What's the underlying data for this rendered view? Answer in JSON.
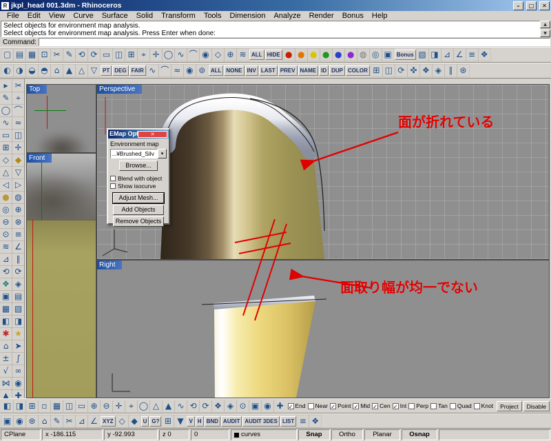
{
  "window": {
    "title": "jkpl_head 001.3dm - Rhinoceros",
    "min": "–",
    "max": "□",
    "close": "✕"
  },
  "menu": {
    "items": [
      "File",
      "Edit",
      "View",
      "Curve",
      "Surface",
      "Solid",
      "Transform",
      "Tools",
      "Dimension",
      "Analyze",
      "Render",
      "Bonus",
      "Help"
    ]
  },
  "command": {
    "history": [
      "Select objects for environment map analysis.",
      "Select objects for environment map analysis. Press Enter when done:"
    ],
    "prompt": "Command:",
    "scroll_up": "▲",
    "scroll_down": "▼"
  },
  "toolbar1": {
    "icons": [
      "▢",
      "▤",
      "▦",
      "⊡",
      "✂",
      "✎",
      "⟲",
      "⟳",
      "▭",
      "◫",
      "⊞",
      "⌖",
      "✛",
      "◯",
      "∿",
      "⌒",
      "◉",
      "◇",
      "⊕",
      "≋",
      {
        "t": "ALL"
      },
      {
        "t": "HIDE"
      },
      {
        "g": "●",
        "c": "#c22000"
      },
      {
        "g": "●",
        "c": "#e07800"
      },
      {
        "g": "●",
        "c": "#d8c400"
      },
      {
        "g": "●",
        "c": "#1f9a1f"
      },
      {
        "g": "●",
        "c": "#2a3fd0"
      },
      {
        "g": "●",
        "c": "#8a2ad0"
      },
      {
        "g": "◍",
        "c": "#777777"
      },
      "◎",
      "▣",
      {
        "t": "Bonus"
      },
      "▧",
      "◨",
      "⊿",
      "∠",
      "≡",
      "❖"
    ]
  },
  "toolbar2": {
    "icons": [
      "◐",
      "◑",
      "◒",
      "◓",
      "⌂",
      "▲",
      "△",
      "▽",
      {
        "t": "PT"
      },
      {
        "t": "DEG"
      },
      {
        "t": "FAIR"
      },
      "∿",
      "⌒",
      "≈",
      "◉",
      "⊚",
      {
        "t": "ALL"
      },
      {
        "t": "NONE"
      },
      {
        "t": "INV"
      },
      {
        "t": "LAST"
      },
      {
        "t": "PREV"
      },
      {
        "t": "NAME"
      },
      {
        "t": "ID"
      },
      {
        "t": "DUP"
      },
      {
        "t": "COLOR"
      },
      "⊞",
      "◫",
      "⟳",
      "✜",
      "❖",
      "◈",
      "∥",
      "⊛"
    ]
  },
  "leftbar": {
    "icons": [
      "▸",
      "✂",
      "✎",
      "⌖",
      "◯",
      "⌒",
      "∿",
      "≈",
      "▭",
      "◫",
      "⊞",
      "✛",
      "◇",
      {
        "g": "◆",
        "c": "#b08820"
      },
      "△",
      "▽",
      "◁",
      "▷",
      {
        "g": "●",
        "c": "#b59a3f"
      },
      "◍",
      "◎",
      "⊕",
      "⊖",
      "⊗",
      "⊙",
      "≡",
      "≋",
      "∠",
      "⊿",
      "∥",
      "⟲",
      "⟳",
      {
        "g": "❖",
        "c": "#1f7f7f"
      },
      "◈",
      "▣",
      "▤",
      "▦",
      "▧",
      "◧",
      "◨",
      {
        "g": "✱",
        "c": "#c22222"
      },
      {
        "g": "★",
        "c": "#caa520"
      },
      "⌂",
      "➤",
      "±",
      "∫",
      "√",
      "∞",
      "⋈",
      "◉",
      "▲",
      "✚"
    ]
  },
  "viewports": {
    "top": "Top",
    "front": "Front",
    "perspective": "Perspective",
    "right": "Right"
  },
  "dialog": {
    "title": "EMap Options",
    "close": "✕",
    "env_label": "Environment map",
    "dropdown": "...¥Brushed_Silv",
    "arrow": "▾",
    "browse": "Browse...",
    "blend": "Blend with object",
    "isocurve": "Show isocurve",
    "adjust": "Adjust Mesh...",
    "add": "Add Objects",
    "remove": "Remove Objects"
  },
  "annotations": {
    "fold": "面が折れている",
    "chamfer": "面取り幅が均一でない"
  },
  "bottomA": {
    "icons": [
      "◧",
      "◨",
      "⊞",
      "▫",
      "▦",
      "◫",
      "▭",
      "⊕",
      "⊖",
      "✛",
      "⌖",
      "◯",
      "△",
      "▲",
      "∿",
      "⟲",
      "⟳",
      "❖",
      "◈",
      "⊙",
      "▣",
      "◉",
      "✚"
    ]
  },
  "bottomB": {
    "icons": [
      "▣",
      "◉",
      "⊛",
      "⌂",
      "✎",
      "✂",
      "⊿",
      "∠",
      {
        "t": "XYZ"
      },
      "◇",
      "◆",
      {
        "t": "U"
      },
      {
        "t": "G?"
      },
      "⊞",
      "▼",
      {
        "t": "V"
      },
      {
        "t": "H"
      },
      {
        "t": "BND"
      },
      {
        "t": "AUDIT"
      },
      {
        "t": "AUDIT 3DES"
      },
      {
        "t": "LIST"
      },
      "≡",
      "❖"
    ]
  },
  "osnap": {
    "items": [
      {
        "label": "End",
        "checked": true
      },
      {
        "label": "Near",
        "checked": false
      },
      {
        "label": "Point",
        "checked": true
      },
      {
        "label": "Mid",
        "checked": true
      },
      {
        "label": "Cen",
        "checked": true
      },
      {
        "label": "Int",
        "checked": true
      },
      {
        "label": "Perp",
        "checked": false
      },
      {
        "label": "Tan",
        "checked": false
      },
      {
        "label": "Quad",
        "checked": false
      },
      {
        "label": "Knot",
        "checked": false
      }
    ],
    "project": "Project",
    "disable": "Disable"
  },
  "statusbar": {
    "cplane": "CPlane",
    "x": "x  -186.115",
    "y": "y  -92.993",
    "z": "z  0",
    "zero": "0",
    "layer": "curves",
    "snap": "Snap",
    "ortho": "Ortho",
    "planar": "Planar",
    "osnap": "Osnap"
  }
}
